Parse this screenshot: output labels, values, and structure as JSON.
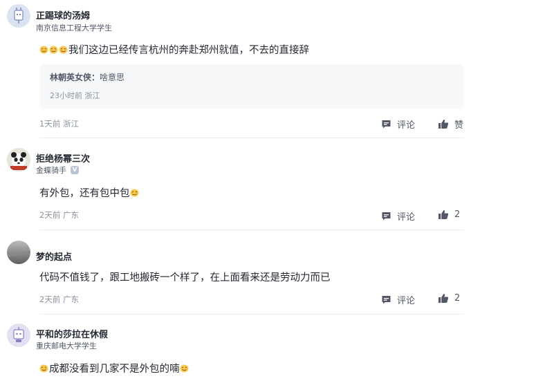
{
  "comments": [
    {
      "username": "正踢球的汤姆",
      "affiliation": "南京信息工程大学学生",
      "avatar_icon": "plug-robot-icon",
      "text": "我们这边已经传言杭州的奔赴郑州就值，不去的直接辞",
      "quote": {
        "author": "林朝英女侠",
        "separator": "：",
        "text": "啥意思",
        "meta": "23小时前 浙江"
      },
      "meta": "1天前 浙江",
      "comment_label": "评论",
      "like_label": "赞"
    },
    {
      "username": "拒绝杨幂三次",
      "badge": "金蝶骑手",
      "badge_icon": "v-icon",
      "avatar_icon": "panda-photo-icon",
      "text": "有外包，还有包中包",
      "meta": "2天前 广东",
      "comment_label": "评论",
      "like_label": "2"
    },
    {
      "username": "梦的起点",
      "avatar_icon": "gray-photo-icon",
      "text": "代码不值钱了，跟工地搬砖一个样了，在上面看来还是劳动力而已",
      "meta": "2天前 广东",
      "comment_label": "评论",
      "like_label": "2"
    },
    {
      "username": "平和的莎拉在休假",
      "affiliation": "重庆邮电大学学生",
      "avatar_icon": "robot-icon",
      "text": "成都没看到几家不是外包的喃"
    }
  ],
  "colors": {
    "text": "#252933",
    "meta": "#8a919f",
    "quote_bg": "#f7f8fa",
    "emoji": "#f9c74f"
  }
}
